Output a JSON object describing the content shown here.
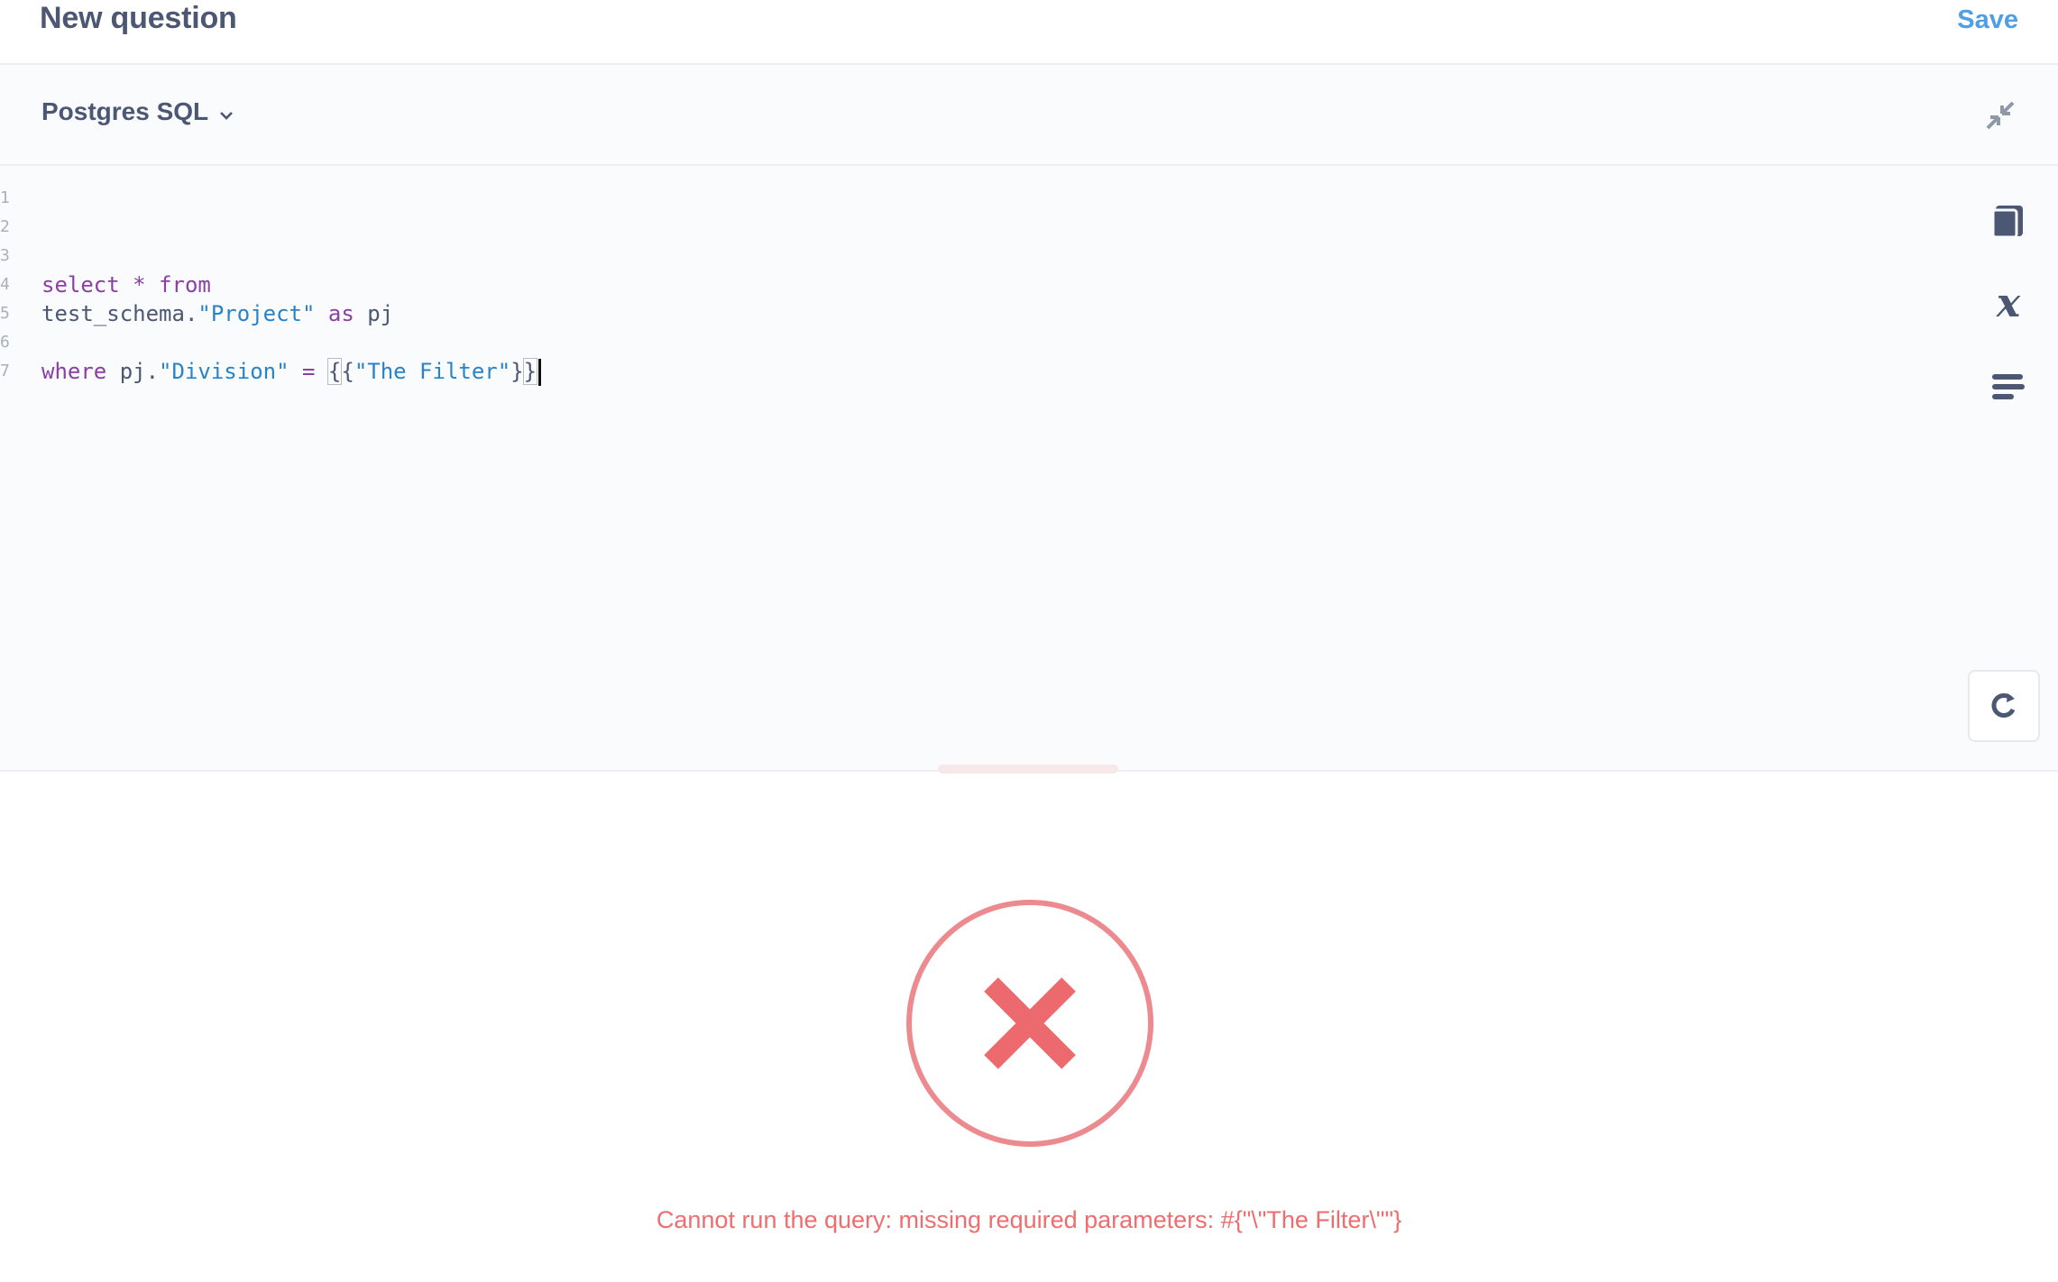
{
  "header": {
    "title": "New question",
    "save_label": "Save"
  },
  "editor_bar": {
    "database": "Postgres SQL"
  },
  "editor": {
    "line_numbers": [
      "1",
      "2",
      "3",
      "4",
      "5",
      "6",
      "7"
    ],
    "lines": [
      "",
      "",
      "",
      "select * from",
      "test_schema.\"Project\" as pj",
      "",
      "where pj.\"Division\" = {{\"The Filter\"}}"
    ],
    "tokens": {
      "l4_select": "select",
      "l4_star": " * ",
      "l4_from": "from",
      "l5_schema": "test_schema.",
      "l5_table": "\"Project\"",
      "l5_as": " as",
      "l5_alias": " pj",
      "l7_where": "where",
      "l7_ref": " pj.",
      "l7_col": "\"Division\"",
      "l7_eq": " = ",
      "l7_open_brace": "{",
      "l7_open_brace2": "{",
      "l7_param": "\"The Filter\"",
      "l7_close_brace": "}",
      "l7_close_brace2": "}"
    }
  },
  "icons": {
    "collapse": "collapse-arrows-icon",
    "data_reference": "book-icon",
    "variables": "variable-x-icon",
    "snippets": "lines-icon",
    "run": "refresh-icon",
    "error": "error-x-circle-icon"
  },
  "colors": {
    "accent": "#509ee3",
    "error": "#ed6e6e",
    "text": "#4c5773",
    "keyword": "#8b3fa5",
    "string": "#2a83c8"
  },
  "error": {
    "message": "Cannot run the query: missing required parameters: #{\"\\\"The Filter\\\"\"}"
  }
}
